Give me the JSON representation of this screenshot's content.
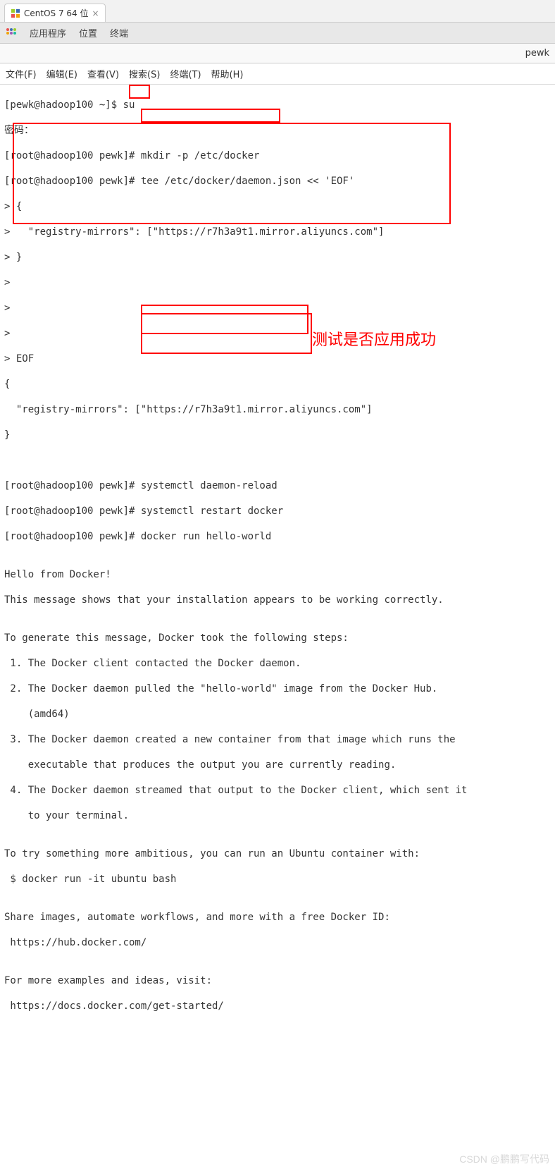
{
  "tab": {
    "title": "CentOS 7 64 位",
    "close": "×"
  },
  "os_menu": {
    "apps": "应用程序",
    "location": "位置",
    "terminal": "终端"
  },
  "titlebar": {
    "right_text": "pewk"
  },
  "term_menu": {
    "file": "文件(F)",
    "edit": "编辑(E)",
    "view": "查看(V)",
    "search": "搜索(S)",
    "terminal": "终端(T)",
    "help": "帮助(H)"
  },
  "lines": {
    "l0": "[pewk@hadoop100 ~]$ su",
    "l1": "密码：",
    "l2": "[root@hadoop100 pewk]# mkdir -p /etc/docker",
    "l3": "[root@hadoop100 pewk]# tee /etc/docker/daemon.json << 'EOF'",
    "l4": "> {",
    "l5": ">   \"registry-mirrors\": [\"https://r7h3a9t1.mirror.aliyuncs.com\"]",
    "l6": "> }",
    "l7": ">",
    "l8": ">",
    "l9": ">",
    "l10": "> EOF",
    "l11": "{",
    "l12": "  \"registry-mirrors\": [\"https://r7h3a9t1.mirror.aliyuncs.com\"]",
    "l13": "}",
    "l14": "",
    "l15": "",
    "l16": "[root@hadoop100 pewk]# systemctl daemon-reload",
    "l17": "[root@hadoop100 pewk]# systemctl restart docker",
    "l18": "[root@hadoop100 pewk]# docker run hello-world",
    "l19": "",
    "l20": "Hello from Docker!",
    "l21": "This message shows that your installation appears to be working correctly.",
    "l22": "",
    "l23": "To generate this message, Docker took the following steps:",
    "l24": " 1. The Docker client contacted the Docker daemon.",
    "l25": " 2. The Docker daemon pulled the \"hello-world\" image from the Docker Hub.",
    "l26": "    (amd64)",
    "l27": " 3. The Docker daemon created a new container from that image which runs the",
    "l28": "    executable that produces the output you are currently reading.",
    "l29": " 4. The Docker daemon streamed that output to the Docker client, which sent it",
    "l30": "    to your terminal.",
    "l31": "",
    "l32": "To try something more ambitious, you can run an Ubuntu container with:",
    "l33": " $ docker run -it ubuntu bash",
    "l34": "",
    "l35": "Share images, automate workflows, and more with a free Docker ID:",
    "l36": " https://hub.docker.com/",
    "l37": "",
    "l38": "For more examples and ideas, visit:",
    "l39": " https://docs.docker.com/get-started/"
  },
  "annotation": "测试是否应用成功",
  "watermark": "CSDN @鹏鹏写代码"
}
